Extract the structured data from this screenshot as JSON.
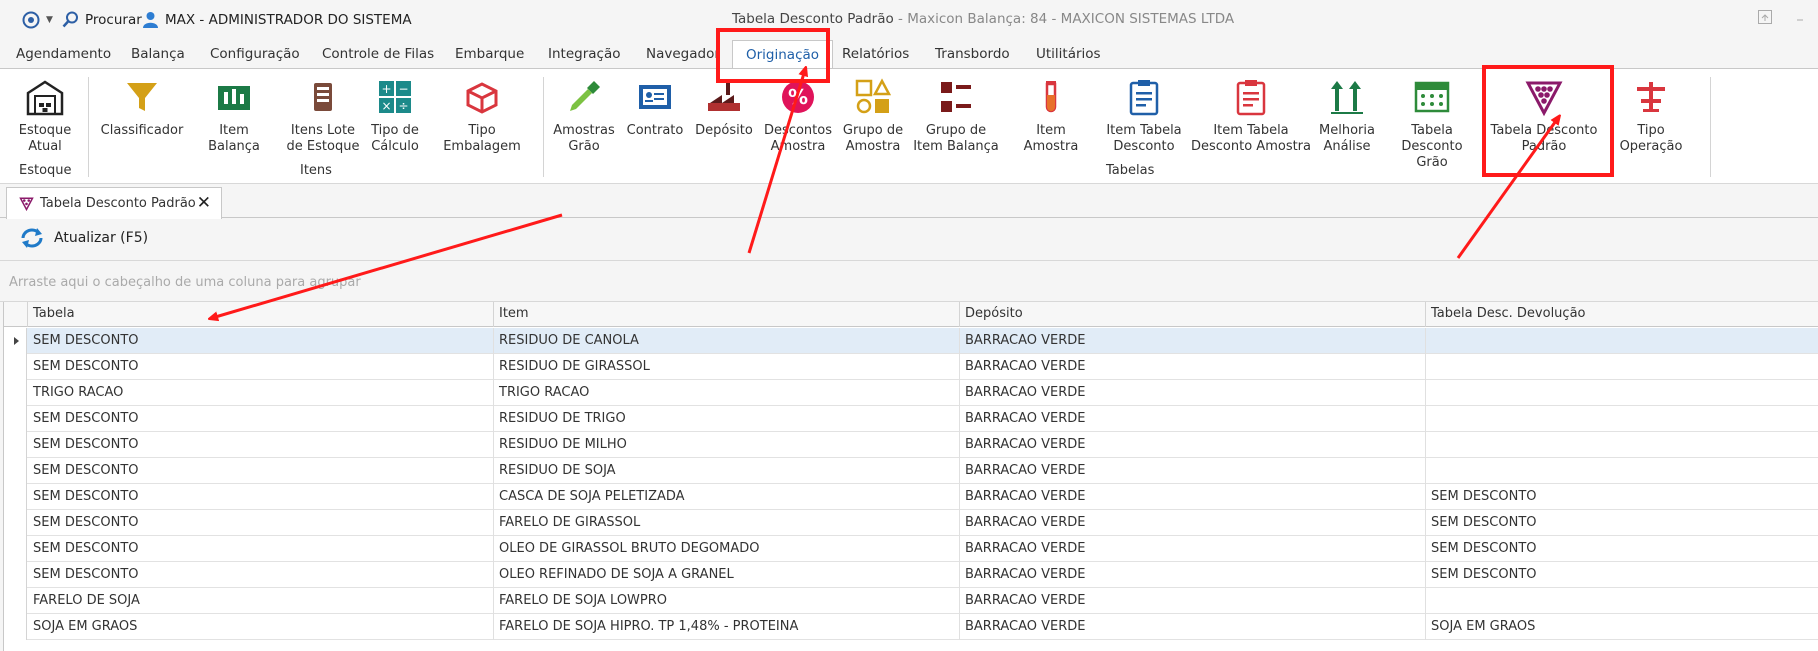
{
  "titlebar": {
    "search_label": "Procurar",
    "user_label": "MAX - ADMINISTRADOR DO SISTEMA",
    "title_main": "Tabela Desconto Padrão",
    "title_sub": " - Maxicon Balança: 84 - MAXICON SISTEMAS LTDA"
  },
  "tabs": [
    "Agendamento",
    "Balança",
    "Configuração",
    "Controle de Filas",
    "Embarque",
    "Integração",
    "Navegador",
    "Originação",
    "Relatórios",
    "Transbordo",
    "Utilitários"
  ],
  "ribbon": {
    "groups": [
      "Estoque",
      "Itens",
      "Tabelas"
    ],
    "buttons": [
      {
        "label": "Estoque\nAtual",
        "icon": "warehouse-icon"
      },
      {
        "label": "Classificador",
        "icon": "funnel-icon"
      },
      {
        "label": "Item Balança",
        "icon": "scale-item-icon"
      },
      {
        "label": "Itens Lote\nde Estoque",
        "icon": "stock-lot-icon"
      },
      {
        "label": "Tipo de\nCálculo",
        "icon": "calculator-icon"
      },
      {
        "label": "Tipo Embalagem",
        "icon": "package-icon"
      },
      {
        "label": "Amostras\nGrão",
        "icon": "pipette-icon"
      },
      {
        "label": "Contrato",
        "icon": "contract-card-icon"
      },
      {
        "label": "Depósito",
        "icon": "factory-icon"
      },
      {
        "label": "Descontos\nAmostra",
        "icon": "percent-badge-icon"
      },
      {
        "label": "Grupo de\nAmostra",
        "icon": "shapes-group-icon"
      },
      {
        "label": "Grupo de\nItem Balança",
        "icon": "list-group-icon"
      },
      {
        "label": "Item Amostra",
        "icon": "test-tube-icon"
      },
      {
        "label": "Item Tabela\nDesconto",
        "icon": "clipboard-icon"
      },
      {
        "label": "Item Tabela\nDesconto Amostra",
        "icon": "clipboard-red-icon"
      },
      {
        "label": "Melhoria\nAnálise",
        "icon": "up-arrows-icon"
      },
      {
        "label": "Tabela\nDesconto Grão",
        "icon": "grain-table-icon"
      },
      {
        "label": "Tabela Desconto\nPadrão",
        "icon": "shield-dots-icon"
      },
      {
        "label": "Tipo Operação",
        "icon": "operation-type-icon"
      }
    ]
  },
  "document": {
    "tab_label": "Tabela Desconto Padrão",
    "close_glyph": "✕"
  },
  "toolbar": {
    "refresh_label": "Atualizar (F5)"
  },
  "grouppanel": {
    "hint": "Arraste aqui o cabeçalho de uma coluna para agrupar"
  },
  "grid": {
    "columns": [
      "Tabela",
      "Item",
      "Depósito",
      "Tabela Desc. Devolução"
    ],
    "rows": [
      [
        "SEM DESCONTO",
        "RESIDUO DE CANOLA",
        "BARRACAO VERDE",
        ""
      ],
      [
        "SEM DESCONTO",
        "RESIDUO DE GIRASSOL",
        "BARRACAO VERDE",
        ""
      ],
      [
        "TRIGO RACAO",
        "TRIGO RACAO",
        "BARRACAO VERDE",
        ""
      ],
      [
        "SEM DESCONTO",
        "RESIDUO DE TRIGO",
        "BARRACAO VERDE",
        ""
      ],
      [
        "SEM DESCONTO",
        "RESIDUO DE MILHO",
        "BARRACAO VERDE",
        ""
      ],
      [
        "SEM DESCONTO",
        "RESIDUO DE SOJA",
        "BARRACAO VERDE",
        ""
      ],
      [
        "SEM DESCONTO",
        "CASCA DE SOJA PELETIZADA",
        "BARRACAO VERDE",
        "SEM DESCONTO"
      ],
      [
        "SEM DESCONTO",
        "FARELO DE GIRASSOL",
        "BARRACAO VERDE",
        "SEM DESCONTO"
      ],
      [
        "SEM DESCONTO",
        "OLEO DE GIRASSOL BRUTO DEGOMADO",
        "BARRACAO VERDE",
        "SEM DESCONTO"
      ],
      [
        "SEM DESCONTO",
        "OLEO REFINADO DE SOJA A GRANEL",
        "BARRACAO VERDE",
        "SEM DESCONTO"
      ],
      [
        "FARELO DE SOJA",
        "FARELO DE SOJA LOWPRO",
        "BARRACAO VERDE",
        ""
      ],
      [
        "SOJA EM GRAOS",
        "FARELO DE SOJA HIPRO. TP 1,48% - PROTEINA",
        "BARRACAO VERDE",
        "SOJA EM GRAOS"
      ]
    ]
  },
  "colors": {
    "accent": "#1f5fa8",
    "annotation": "#ff1a1a",
    "selected_row": "#e1ecf7"
  }
}
